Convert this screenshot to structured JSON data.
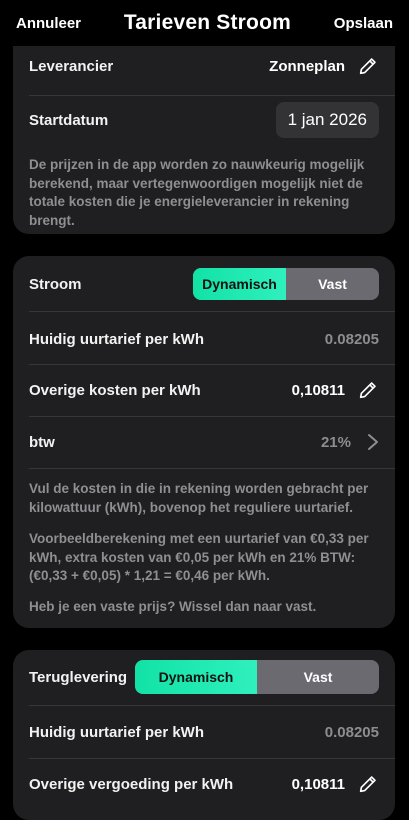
{
  "header": {
    "cancel": "Annuleer",
    "title": "Tarieven Stroom",
    "save": "Opslaan"
  },
  "general": {
    "supplier_label": "Leverancier",
    "supplier_value": "Zonneplan",
    "start_label": "Startdatum",
    "start_value": "1 jan 2026",
    "note": "De prijzen in de app worden zo nauwkeurig mogelijk berekend, maar vertegenwoordigen mogelijk niet de totale kosten die je energieleverancier in rekening brengt."
  },
  "stroom": {
    "title": "Stroom",
    "toggle_active": "Dynamisch",
    "toggle_inactive": "Vast",
    "current_label": "Huidig uurtarief per kWh",
    "current_value": "0.08205",
    "other_label": "Overige kosten per kWh",
    "other_value": "0,10811",
    "vat_label": "btw",
    "vat_value": "21%",
    "note1": "Vul de kosten in die in rekening worden gebracht per kilowattuur (kWh), bovenop het reguliere uurtarief.",
    "note2": "Voorbeeldberekening met een uurtarief van €0,33 per kWh, extra kosten van €0,05 per kWh en 21% BTW: (€0,33 + €0,05) * 1,21 = €0,46 per kWh.",
    "note3": "Heb je een vaste prijs? Wissel dan naar vast."
  },
  "teruglevering": {
    "title": "Teruglevering",
    "toggle_active": "Dynamisch",
    "toggle_inactive": "Vast",
    "current_label": "Huidig uurtarief per kWh",
    "current_value": "0.08205",
    "other_label": "Overige vergoeding per kWh",
    "other_value": "0,10811"
  },
  "icons": {
    "edit": "pencil-icon",
    "next": "chevron-right-icon"
  },
  "colors": {
    "accent": "#1DE9B6",
    "card": "#1F1F21",
    "muted": "#8E8E93"
  }
}
